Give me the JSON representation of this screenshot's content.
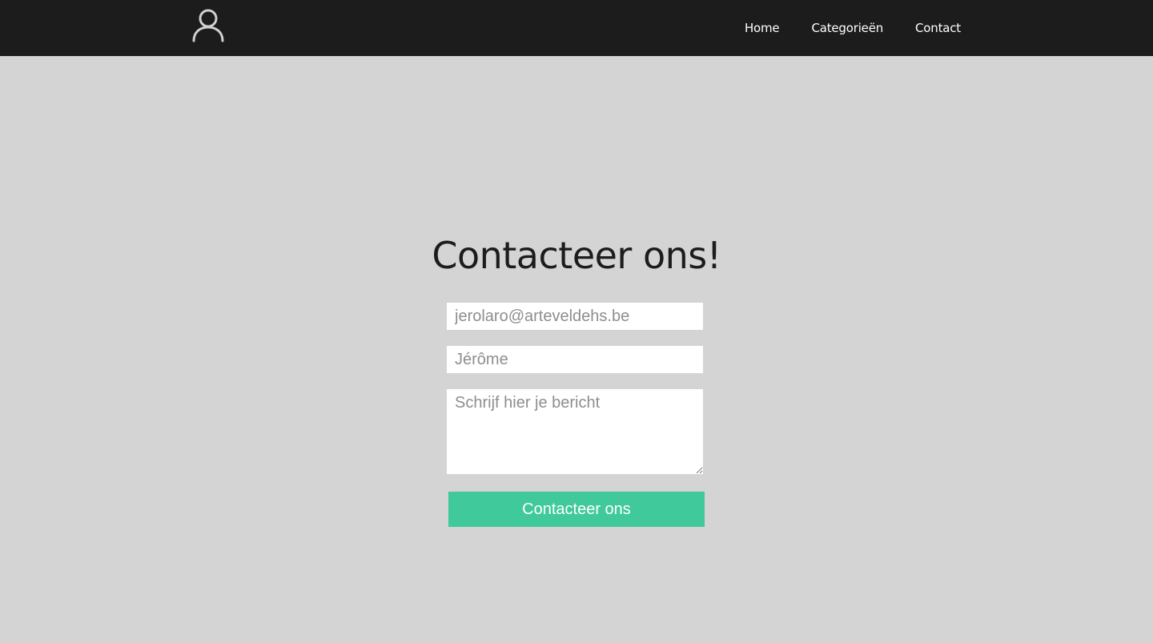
{
  "header": {
    "avatar_icon": "user-icon",
    "nav": [
      {
        "label": "Home"
      },
      {
        "label": "Categorieën"
      },
      {
        "label": "Contact"
      }
    ]
  },
  "main": {
    "title": "Contacteer ons!",
    "form": {
      "email": {
        "placeholder": "jerolaro@arteveldehs.be",
        "value": ""
      },
      "name": {
        "placeholder": "Jérôme",
        "value": ""
      },
      "message": {
        "placeholder": "Schrijf hier je bericht",
        "value": ""
      },
      "submit_label": "Contacteer ons"
    }
  },
  "colors": {
    "header_bg": "#1c1c1c",
    "page_bg": "#d4d4d4",
    "accent": "#40c99a"
  }
}
